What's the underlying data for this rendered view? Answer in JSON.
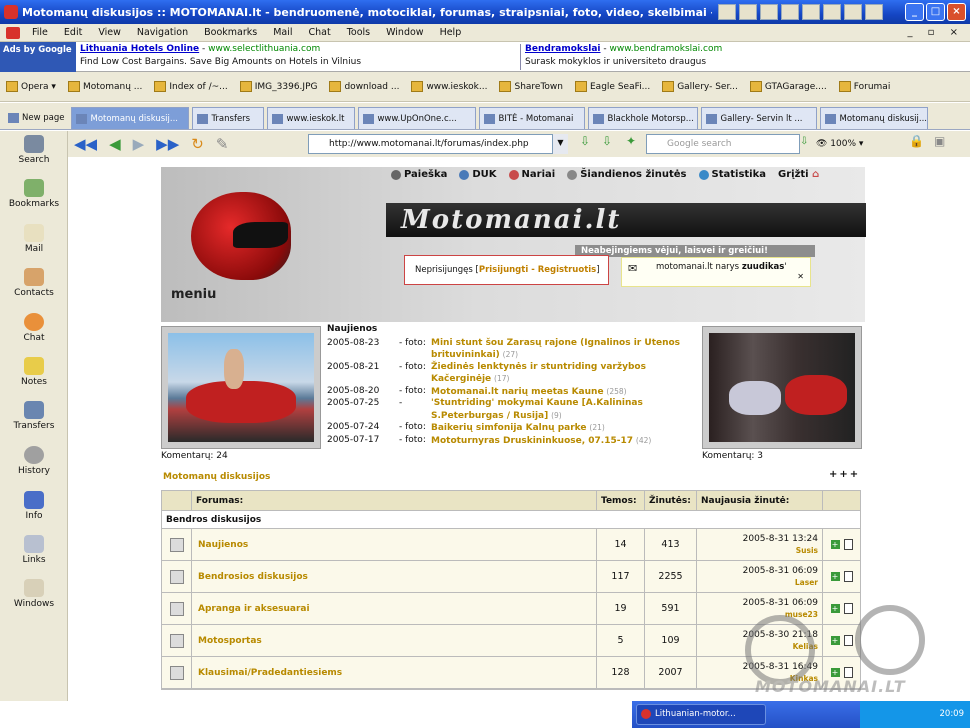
{
  "window": {
    "title": "Motomanų diskusijos :: MOTOMANAI.lt - bendruomenė, motociklai, forumas, straipsniai, foto, video, skelbimai - Opera"
  },
  "menu": [
    "File",
    "Edit",
    "View",
    "Navigation",
    "Bookmarks",
    "Mail",
    "Chat",
    "Tools",
    "Window",
    "Help"
  ],
  "ads": {
    "ads_by": "Ads by Google",
    "ad1": {
      "title": "Lithuania Hotels Online",
      "url": "www.selectlithuania.com",
      "text": "Find Low Cost Bargains. Save Big Amounts on Hotels in Vilnius"
    },
    "ad2": {
      "title": "Bendramokslai",
      "url": "www.bendramokslai.com",
      "text": "Surask mokyklos ir universiteto draugus"
    }
  },
  "bookmarks": [
    "Opera",
    "Motomanų ...",
    "Index of /~...",
    "IMG_3396.JPG",
    "download ...",
    "www.ieskok...",
    "ShareTown",
    "Eagle SeaFi...",
    "Gallery- Ser...",
    "GTAGarage....",
    "Forumai"
  ],
  "tabs": [
    "New page",
    "Motomanų diskusij...",
    "Transfers",
    "www.ieskok.lt",
    "www.UpOnOne.c...",
    "BITĖ - Motomanai",
    "Blackhole Motorsp...",
    "Gallery- Servin lt ...",
    "Motomanų diskusij..."
  ],
  "address": {
    "url": "http://www.motomanai.lt/forumas/index.php",
    "search_placeholder": "Google search",
    "zoom": "100%"
  },
  "sidebar": [
    "Search",
    "Bookmarks",
    "Mail",
    "Contacts",
    "Chat",
    "Notes",
    "Transfers",
    "History",
    "Info",
    "Links",
    "Windows"
  ],
  "site": {
    "nav": [
      "Paieška",
      "DUK",
      "Nariai",
      "Šiandienos žinutės",
      "Statistika",
      "Grįžti"
    ],
    "logo": "Motomanai.lt",
    "meniu": "meniu",
    "slogan": "Neabejingiems vėjui, laisvei ir greičiui!",
    "login_prefix": "Neprisijungęs [",
    "login_link": "Prisijungti",
    "login_sep": " - ",
    "register_link": "Registruotis",
    "login_suffix": "]",
    "member_prefix": "motomanai.lt narys ",
    "member_name": "zuudikas",
    "member_suffix": "'",
    "comments1": "Komentarų: 24",
    "comments2": "Komentarų: 3",
    "news_title": "Naujienos",
    "news": [
      {
        "date": "2005-08-23",
        "label": "- foto:",
        "title": "Mini stunt šou Zarasų rajone (Ignalinos ir Utenos brituvininkai)",
        "count": "(27)"
      },
      {
        "date": "2005-08-21",
        "label": "- foto:",
        "title": "Žiedinės lenktynės ir stuntriding varžybos Kačerginėje",
        "count": "(17)"
      },
      {
        "date": "2005-08-20",
        "label": "- foto:",
        "title": "Motomanai.lt narių meetas Kaune",
        "count": "(258)"
      },
      {
        "date": "2005-07-25",
        "label": "-",
        "title": "'Stuntriding' mokymai Kaune [A.Kalininas S.Peterburgas / Rusija]",
        "count": "(9)"
      },
      {
        "date": "2005-07-24",
        "label": "- foto:",
        "title": "Baikerių simfonija Kalnų parke",
        "count": "(21)"
      },
      {
        "date": "2005-07-17",
        "label": "- foto:",
        "title": "Mototurnyras Druskininkuose, 07.15-17",
        "count": "(42)"
      }
    ],
    "breadcrumb": "Motomanų diskusijos",
    "plus": "+++"
  },
  "forum": {
    "headers": [
      "Forumas:",
      "Temos:",
      "Žinutės:",
      "Naujausia žinutė:"
    ],
    "category": "Bendros diskusijos",
    "rows": [
      {
        "name": "Naujienos",
        "topics": "14",
        "posts": "413",
        "last_date": "2005-8-31 13:24",
        "last_user": "Susis"
      },
      {
        "name": "Bendrosios diskusijos",
        "topics": "117",
        "posts": "2255",
        "last_date": "2005-8-31 06:09",
        "last_user": "Laser"
      },
      {
        "name": "Apranga ir aksesuarai",
        "topics": "19",
        "posts": "591",
        "last_date": "2005-8-31 06:09",
        "last_user": "muse23"
      },
      {
        "name": "Motosportas",
        "topics": "5",
        "posts": "109",
        "last_date": "2005-8-30 21:18",
        "last_user": "Kelias"
      },
      {
        "name": "Klausimai/Pradedantiesiems",
        "topics": "128",
        "posts": "2007",
        "last_date": "2005-8-31 16:49",
        "last_user": "Kinkas"
      }
    ]
  },
  "watermark": "MOTOMANAI.LT",
  "taskbar": {
    "task": "Lithuanian-motor...",
    "clock": "20:09"
  }
}
